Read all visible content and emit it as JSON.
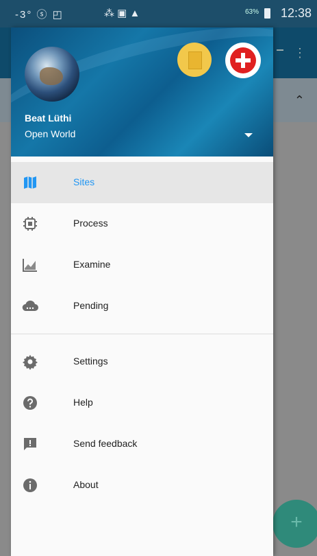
{
  "status_bar": {
    "left_icons": "-3° ⓢ ◰",
    "mid_icons": "⁂ ▣ ▲",
    "battery": "63%",
    "time": "12:38"
  },
  "header": {
    "user_name": "Beat Lüthi",
    "account": "Open World"
  },
  "menu": [
    {
      "label": "Sites",
      "icon": "map-icon",
      "active": true
    },
    {
      "label": "Process",
      "icon": "chip-icon",
      "active": false
    },
    {
      "label": "Examine",
      "icon": "chart-icon",
      "active": false
    },
    {
      "label": "Pending",
      "icon": "cloud-upload-icon",
      "active": false
    }
  ],
  "secondary_menu": [
    {
      "label": "Settings",
      "icon": "gear-icon"
    },
    {
      "label": "Help",
      "icon": "help-icon"
    },
    {
      "label": "Send feedback",
      "icon": "feedback-icon"
    },
    {
      "label": "About",
      "icon": "info-icon"
    }
  ],
  "colors": {
    "accent": "#2196f3",
    "header_blue": "#0e5a8a",
    "fab": "#2f8a7a",
    "flag_red": "#e02020",
    "coin_yellow": "#f2c84b"
  },
  "background_app": {
    "fab_symbol": "+"
  }
}
